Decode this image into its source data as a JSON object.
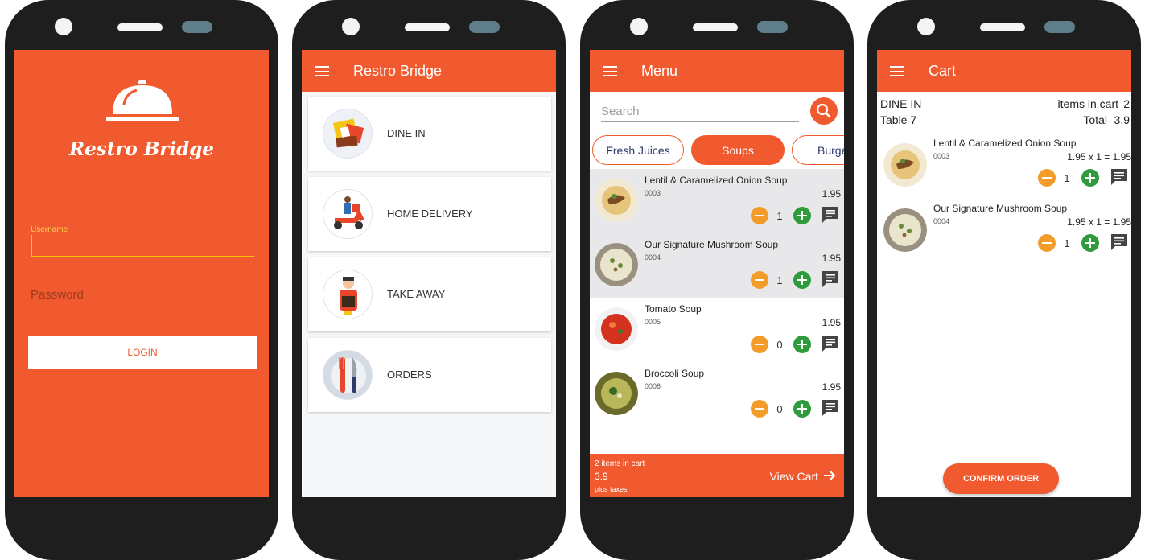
{
  "login": {
    "brand": "Restro Bridge",
    "username_label": "Username",
    "username_value": "",
    "password_placeholder": "Password",
    "login_label": "LOGIN"
  },
  "home": {
    "title": "Restro Bridge",
    "options": [
      {
        "label": "DINE IN",
        "icon": "dine-in-icon"
      },
      {
        "label": "HOME DELIVERY",
        "icon": "delivery-scooter-icon"
      },
      {
        "label": "TAKE AWAY",
        "icon": "take-away-icon"
      },
      {
        "label": "ORDERS",
        "icon": "fork-knife-icon"
      }
    ]
  },
  "menu": {
    "title": "Menu",
    "search_placeholder": "Search",
    "categories": [
      {
        "label": "Fresh Juices",
        "active": false
      },
      {
        "label": "Soups",
        "active": true
      },
      {
        "label": "Burge",
        "active": false
      }
    ],
    "items": [
      {
        "name": "Lentil & Caramelized Onion Soup",
        "code": "0003",
        "price": "1.95",
        "qty": "1",
        "selected": true
      },
      {
        "name": "Our Signature Mushroom Soup",
        "code": "0004",
        "price": "1.95",
        "qty": "1",
        "selected": true
      },
      {
        "name": "Tomato Soup",
        "code": "0005",
        "price": "1.95",
        "qty": "0",
        "selected": false
      },
      {
        "name": "Broccoli Soup",
        "code": "0006",
        "price": "1.95",
        "qty": "0",
        "selected": false
      }
    ],
    "cartbar": {
      "count": "2 items in cart",
      "total": "3.9",
      "taxes": "plus taxes",
      "view": "View Cart"
    }
  },
  "cart": {
    "title": "Cart",
    "mode": "DINE IN",
    "table": "Table 7",
    "items_label": "items in cart",
    "items_count": "2",
    "total_label": "Total",
    "total_value": "3.9",
    "items": [
      {
        "name": "Lentil & Caramelized Onion Soup",
        "code": "0003",
        "price": "1.95",
        "qty": "1",
        "line_total": "1.95"
      },
      {
        "name": "Our Signature Mushroom Soup",
        "code": "0004",
        "price": "1.95",
        "qty": "1",
        "line_total": "1.95"
      }
    ],
    "confirm_label": "CONFIRM ORDER"
  },
  "colors": {
    "accent": "#f05a2e",
    "minus": "#f39c2a",
    "plus": "#2e9b3c",
    "device": "#1e1e1e"
  }
}
